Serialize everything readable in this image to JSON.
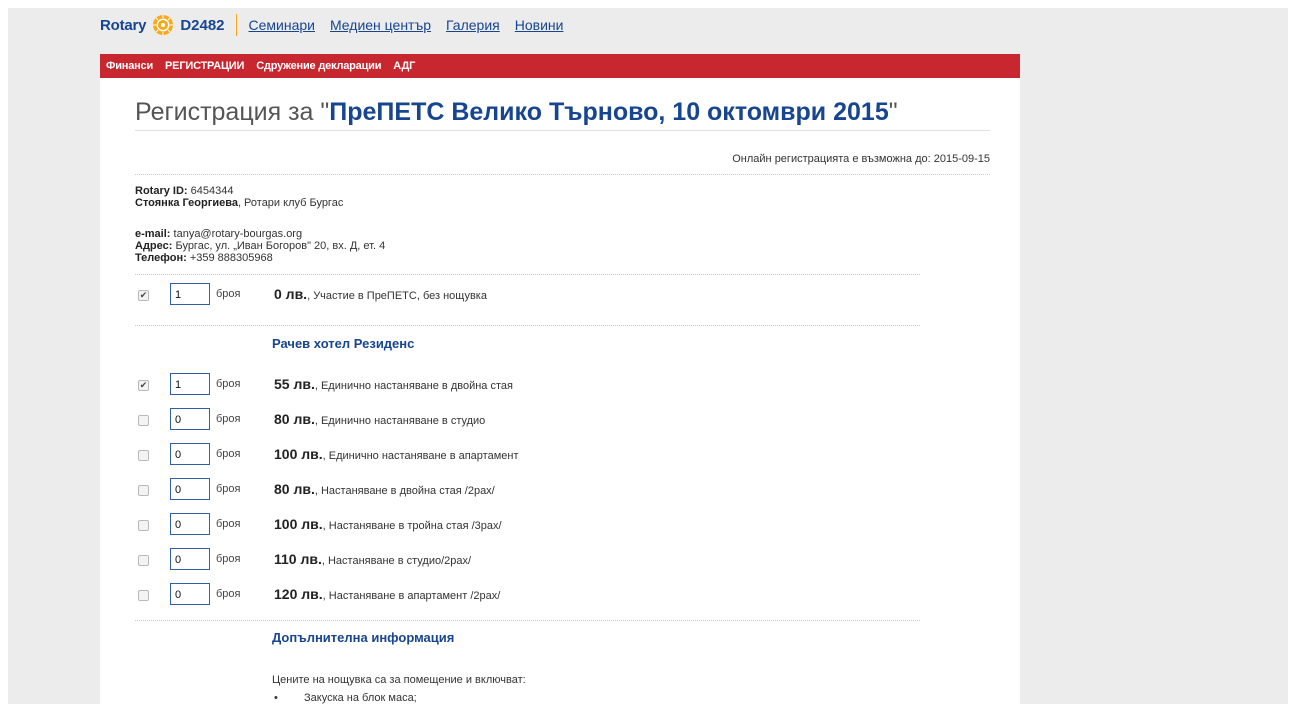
{
  "header": {
    "brand": "Rotary",
    "district": "D2482",
    "links": [
      "Семинари",
      "Медиен център",
      "Галерия",
      "Новини"
    ]
  },
  "menubar": {
    "items": [
      "Финанси",
      "РЕГИСТРАЦИИ",
      "Сдружение декларации",
      "АДГ"
    ]
  },
  "page": {
    "title_prefix": "Регистрация за \"",
    "title_event": "ПреПЕТС Велико Търново, 10 октомври 2015",
    "title_suffix": "\"",
    "deadline": "Онлайн регистрацията е възможна до: 2015-09-15"
  },
  "member": {
    "rotary_id_label": "Rotary ID:",
    "rotary_id": " 6454344",
    "name": "Стоянка Георгиева",
    "club": ", Ротари клуб Бургас",
    "email_label": "e-mail:",
    "email": " tanya@rotary-bourgas.org",
    "address_label": "Адрес:",
    "address": " Бургас, ул. „Иван Богоров\" 20, вх. Д, ет. 4",
    "phone_label": "Телефон:",
    "phone": " +359 888305968"
  },
  "unit_label": "броя",
  "participation": {
    "checked": true,
    "qty": "1",
    "price": "0 лв.",
    "desc": ", Участие в ПреПЕТС, без нощувка"
  },
  "hotel": {
    "name": "Рачев хотел Резиденс",
    "options": [
      {
        "checked": true,
        "qty": "1",
        "price": "55 лв.",
        "desc": ", Единично настаняване в двойна стая"
      },
      {
        "checked": false,
        "qty": "0",
        "price": "80 лв.",
        "desc": ", Единично настаняване в студио"
      },
      {
        "checked": false,
        "qty": "0",
        "price": "100 лв.",
        "desc": ", Единично настаняване в апартамент"
      },
      {
        "checked": false,
        "qty": "0",
        "price": "80 лв.",
        "desc": ", Настаняване в двойна стая /2pax/"
      },
      {
        "checked": false,
        "qty": "0",
        "price": "100 лв.",
        "desc": ", Настаняване в тройна стая /3pax/"
      },
      {
        "checked": false,
        "qty": "0",
        "price": "110 лв.",
        "desc": ", Настаняване в студио/2pax/"
      },
      {
        "checked": false,
        "qty": "0",
        "price": "120 лв.",
        "desc": ", Настаняване в апартамент /2pax/"
      }
    ]
  },
  "extra": {
    "heading": "Допълнителна информация",
    "intro": "Цените на нощувка са за помещение и включват:",
    "bullets": [
      "Закуска на блок маса;"
    ]
  },
  "colors": {
    "brand": "#17458f",
    "menubar": "#c8272f",
    "accent": "#f7a81b"
  }
}
